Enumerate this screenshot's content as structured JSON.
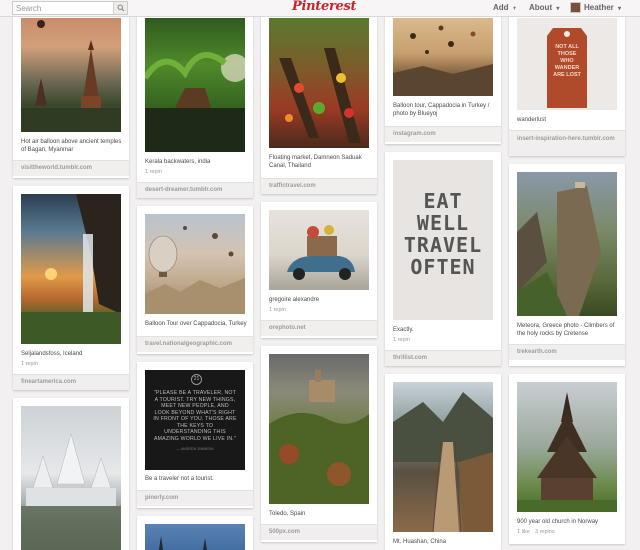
{
  "header": {
    "search_placeholder": "Search",
    "logo": "Pinterest",
    "add_label": "Add",
    "add_caret": "+",
    "about_label": "About",
    "about_caret": "▾",
    "user_name": "Heather",
    "user_caret": "▾"
  },
  "pins": {
    "bagan": {
      "desc": "Hot air balloon above ancient temples of Bagan, Myanmar",
      "src": "visittheworld.tumblr.com"
    },
    "seljalandsfoss": {
      "desc": "Seljalandsfoss, Iceland",
      "repins": "1 repin",
      "src": "fineartamerica.com"
    },
    "kerala": {
      "desc": "Kerala backwaters, india",
      "repins": "1 repin",
      "src": "desert-dreamer.tumblr.com"
    },
    "cappadocia_balloon": {
      "desc": "Balloon Tour over Cappadocia, Turkey",
      "src": "travel.nationalgeographic.com"
    },
    "quote": {
      "number": "21",
      "text": "\"PLEASE BE A TRAVELER, NOT A TOURIST. TRY NEW THINGS, MEET NEW PEOPLE, AND LOOK BEYOND WHAT'S RIGHT IN FRONT OF YOU. THOSE ARE THE KEYS TO UNDERSTANDING THIS AMAZING WORLD WE LIVE IN.\"",
      "author": "— ANDREW ZIMMERN",
      "desc": "Be a traveler not a tourist.",
      "src": "pinerly.com"
    },
    "floating_market": {
      "desc": "Floating market, Damneon Saduak Canal, Thailand",
      "src": "traffictravel.com"
    },
    "gregoire": {
      "desc": "gregoire alexandre",
      "repins": "1 repin",
      "src": "orephoto.net"
    },
    "toledo": {
      "desc": "Toledo, Spain",
      "src": "500px.com"
    },
    "cappadocia_top": {
      "desc": "Balloon tour, Cappadocia in Turkey / photo by Blueyoj",
      "src": "instagram.com"
    },
    "eat_well": {
      "poster": "EAT\nWELL\nTRAVEL\nOFTEN",
      "desc": "Exactly.",
      "repins": "1 repin",
      "src": "thrillist.com"
    },
    "huashan": {
      "desc": "Mt. Huashan, China"
    },
    "wanderlust": {
      "tag_text": "NOT ALL\nTHOSE\nWHO\nWANDER\nARE LOST",
      "desc": "wanderlust",
      "src": "insert-inspiration-here.tumblr.com"
    },
    "meteora": {
      "desc": "Meteora, Greece photo - Climbers of the holy rocks by Cretense",
      "src": "trekearth.com"
    },
    "norway_church": {
      "desc": "900 year old church in Norway",
      "likes": "1 like",
      "repins": "3 repins"
    }
  }
}
